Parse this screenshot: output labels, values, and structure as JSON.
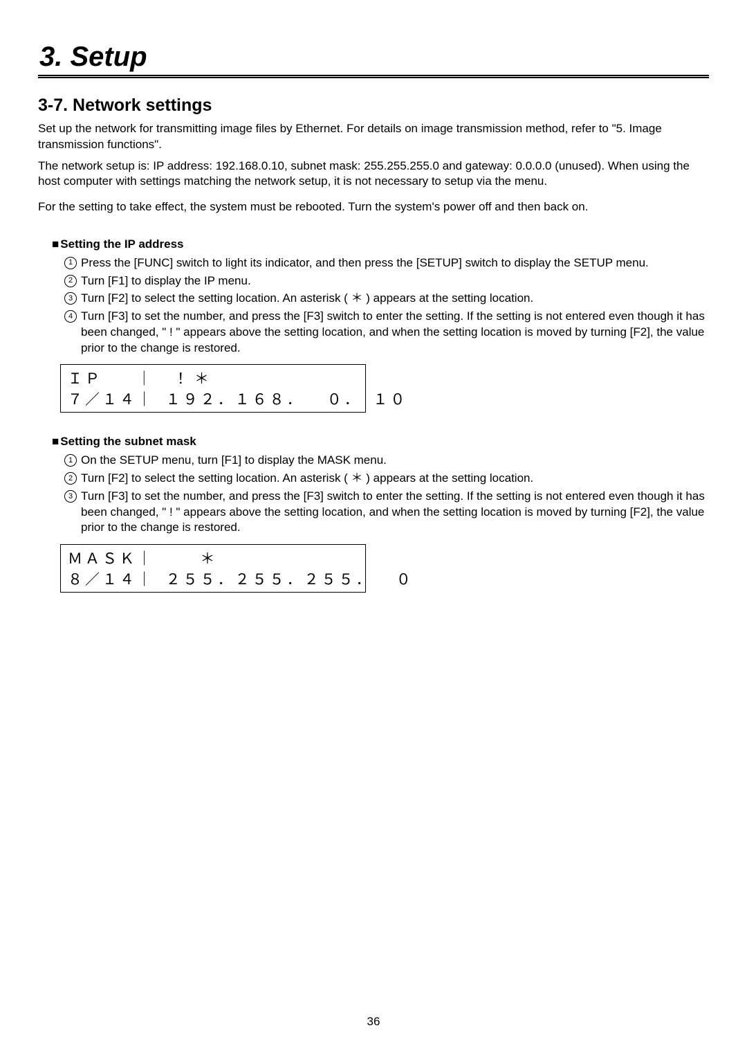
{
  "chapter": "3. Setup",
  "section_title": "3-7. Network settings",
  "intro1": "Set up the network for transmitting image files by Ethernet. For details on image transmission method, refer to \"5. Image transmission functions\".",
  "intro2": "The network setup is: IP address: 192.168.0.10, subnet mask: 255.255.255.0 and gateway: 0.0.0.0 (unused). When using the host computer with settings matching the network setup, it is not necessary to setup via the menu.",
  "intro3": "For the setting to take effect, the system must be rebooted. Turn the system's power off and then back on.",
  "ip_heading": "Setting the IP address",
  "ip_steps": {
    "s1": "Press the [FUNC] switch to light its indicator, and then press the [SETUP] switch to display the SETUP menu.",
    "s2": "Turn [F1] to display the IP menu.",
    "s3": "Turn [F2] to select the setting location. An asterisk ( ＊ ) appears at the setting location.",
    "s4": "Turn [F3] to set the number, and press the [F3] switch to enter the setting. If the setting is not entered even though it has been changed, \" ! \" appears above the setting location, and when the setting location is moved by turning [F2], the value prior to the change is restored."
  },
  "lcd_ip_row1": "ＩＰ   ｜  ！＊",
  "lcd_ip_row2": "７／１４｜ １９２．１６８．  ０． １０",
  "mask_heading": "Setting the subnet mask",
  "mask_steps": {
    "s1": "On the SETUP menu, turn [F1] to display the MASK menu.",
    "s2": "Turn [F2] to select the setting location. An asterisk ( ＊ ) appears at the setting location.",
    "s3": "Turn [F3] to set the number, and press the [F3] switch to enter the setting. If the setting is not entered even though it has been changed, \" ! \" appears above the setting location, and when the setting location is moved by turning [F2], the value prior to the change is restored."
  },
  "lcd_mask_row1": "ＭＡＳＫ｜    ＊",
  "lcd_mask_row2": "８／１４｜ ２５５．２５５．２５５．  ０",
  "page_number": "36"
}
